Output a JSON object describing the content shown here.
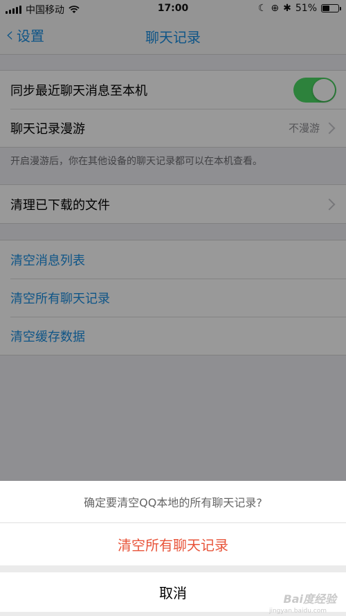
{
  "status_bar": {
    "carrier": "中国移动",
    "time": "17:00",
    "battery_percent": "51%",
    "battery_level": 0.51,
    "icons": [
      "signal-icon",
      "wifi-icon",
      "moon-icon",
      "orientation-lock-icon",
      "bluetooth-icon",
      "battery-icon"
    ]
  },
  "nav": {
    "back_label": "设置",
    "title": "聊天记录"
  },
  "group1": {
    "sync_label": "同步最近聊天消息至本机",
    "sync_on": true,
    "roaming_label": "聊天记录漫游",
    "roaming_value": "不漫游",
    "hint": "开启漫游后，你在其他设备的聊天记录都可以在本机查看。"
  },
  "group2": {
    "clean_files_label": "清理已下载的文件"
  },
  "group3": {
    "items": [
      "清空消息列表",
      "清空所有聊天记录",
      "清空缓存数据"
    ]
  },
  "action_sheet": {
    "message": "确定要清空QQ本地的所有聊天记录?",
    "destructive_label": "清空所有聊天记录",
    "cancel_label": "取消"
  },
  "watermark": {
    "text": "Bai度经验",
    "sub": "jingyan.baidu.com"
  },
  "colors": {
    "accent": "#1a8ee1",
    "toggle_on": "#4cd964",
    "destructive": "#e8543a"
  }
}
